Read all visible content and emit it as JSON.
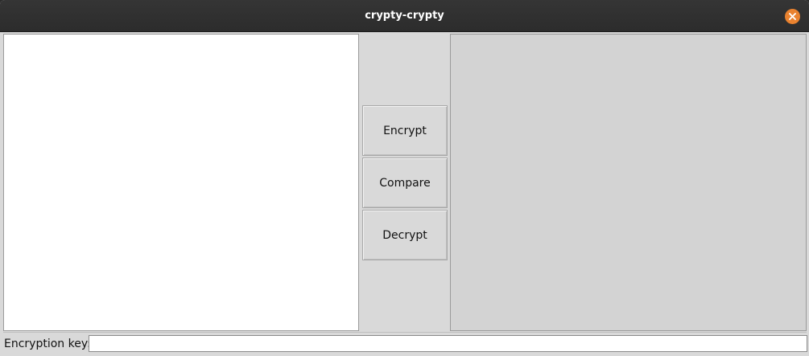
{
  "window": {
    "title": "crypty-crypty",
    "close_icon": "close-icon",
    "accent_color": "#e9822f"
  },
  "actions": {
    "encrypt_label": "Encrypt",
    "compare_label": "Compare",
    "decrypt_label": "Decrypt"
  },
  "input_text": {
    "value": ""
  },
  "output_text": {
    "value": ""
  },
  "key": {
    "label": "Encryption key:",
    "value": "",
    "placeholder": ""
  }
}
